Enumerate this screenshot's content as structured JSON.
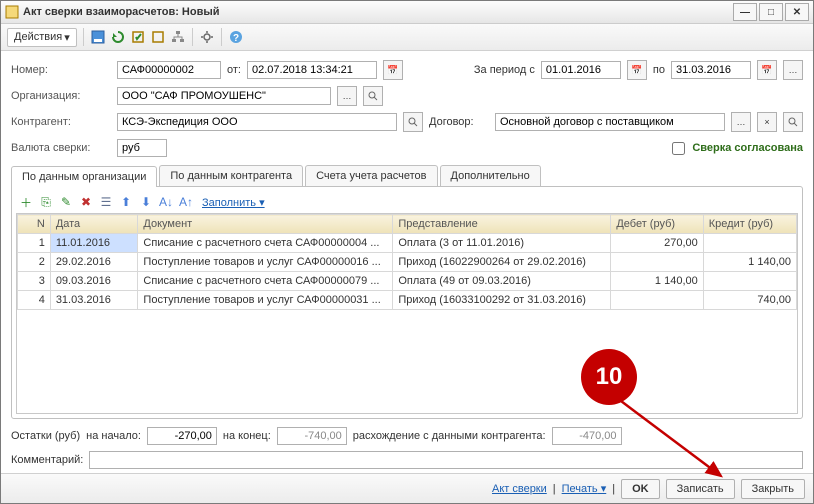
{
  "window": {
    "title": "Акт сверки взаиморасчетов: Новый"
  },
  "toolbar": {
    "actions": "Действия"
  },
  "form": {
    "number_label": "Номер:",
    "number": "САФ00000002",
    "ot": "от:",
    "date": "02.07.2018 13:34:21",
    "period_label": "За период с",
    "period_from": "01.01.2016",
    "po": "по",
    "period_to": "31.03.2016",
    "org_label": "Организация:",
    "org": "ООО \"САФ ПРОМОУШЕНС\"",
    "kontr_label": "Контрагент:",
    "kontr": "КСЭ-Экспедиция ООО",
    "dog_label": "Договор:",
    "dog": "Основной договор с поставщиком",
    "currency_label": "Валюта сверки:",
    "currency": "руб",
    "agreed": "Сверка согласована"
  },
  "tabs": [
    "По данным организации",
    "По данным контрагента",
    "Счета учета расчетов",
    "Дополнительно"
  ],
  "grid_toolbar": {
    "fill": "Заполнить"
  },
  "columns": {
    "n": "N",
    "date": "Дата",
    "doc": "Документ",
    "repr": "Представление",
    "debit": "Дебет (руб)",
    "credit": "Кредит (руб)"
  },
  "rows": [
    {
      "n": "1",
      "date": "11.01.2016",
      "doc": "Списание с расчетного счета САФ00000004 ...",
      "repr": "Оплата (3 от 11.01.2016)",
      "debit": "270,00",
      "credit": ""
    },
    {
      "n": "2",
      "date": "29.02.2016",
      "doc": "Поступление товаров и услуг САФ00000016 ...",
      "repr": "Приход (16022900264 от 29.02.2016)",
      "debit": "",
      "credit": "1 140,00"
    },
    {
      "n": "3",
      "date": "09.03.2016",
      "doc": "Списание с расчетного счета САФ00000079 ...",
      "repr": "Оплата (49 от 09.03.2016)",
      "debit": "1 140,00",
      "credit": ""
    },
    {
      "n": "4",
      "date": "31.03.2016",
      "doc": "Поступление товаров и услуг САФ00000031 ...",
      "repr": "Приход (16033100292 от 31.03.2016)",
      "debit": "",
      "credit": "740,00"
    }
  ],
  "summary": {
    "bal_label": "Остатки (руб)",
    "start_label": "на начало:",
    "start": "-270,00",
    "end_label": "на конец:",
    "end": "-740,00",
    "diff_label": "расхождение с данными контрагента:",
    "diff": "-470,00"
  },
  "comment_label": "Комментарий:",
  "bottom": {
    "act": "Акт сверки",
    "print": "Печать",
    "ok": "OK",
    "save": "Записать",
    "close": "Закрыть"
  },
  "annotation": {
    "num": "10"
  }
}
